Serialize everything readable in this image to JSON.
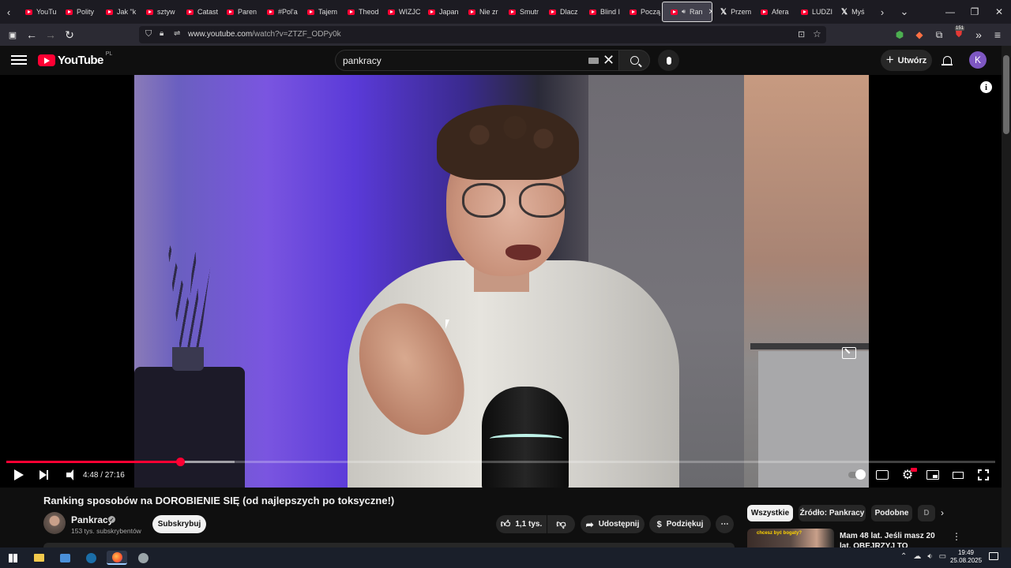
{
  "browser": {
    "tabs": [
      {
        "label": "YouTu",
        "icon": "youtube-icon"
      },
      {
        "label": "Polity",
        "icon": "youtube-icon"
      },
      {
        "label": "Jak \"k",
        "icon": "youtube-icon"
      },
      {
        "label": "sztyw",
        "icon": "youtube-icon"
      },
      {
        "label": "Catast",
        "icon": "youtube-icon"
      },
      {
        "label": "Paren",
        "icon": "youtube-icon"
      },
      {
        "label": "#Pol'a",
        "icon": "youtube-icon"
      },
      {
        "label": "Tajem",
        "icon": "youtube-icon"
      },
      {
        "label": "Theod",
        "icon": "youtube-icon"
      },
      {
        "label": "WIZJC",
        "icon": "youtube-icon"
      },
      {
        "label": "Japan",
        "icon": "youtube-icon"
      },
      {
        "label": "Nie zr",
        "icon": "youtube-icon"
      },
      {
        "label": "Smutr",
        "icon": "youtube-icon"
      },
      {
        "label": "Dlacz",
        "icon": "youtube-icon"
      },
      {
        "label": "Blind I",
        "icon": "youtube-icon"
      },
      {
        "label": "Począ",
        "icon": "youtube-icon"
      }
    ],
    "active_tab": {
      "label": "Ran",
      "icon": "youtube-icon",
      "close": "✕"
    },
    "tabs_after": [
      {
        "label": "Przem",
        "icon": "x-icon"
      },
      {
        "label": "Afera",
        "icon": "youtube-icon"
      },
      {
        "label": "LUDZI",
        "icon": "youtube-icon"
      },
      {
        "label": "Myś",
        "icon": "x-icon"
      }
    ],
    "url_host": "www.youtube.com",
    "url_path": "/watch?v=ZTZF_ODPy0k",
    "extension_badge": "151"
  },
  "youtube": {
    "logo_text": "YouTube",
    "logo_country": "PL",
    "search_value": "pankracy",
    "create_label": "Utwórz",
    "avatar_letter": "K"
  },
  "player": {
    "time_current": "4:48",
    "time_total": "27:16",
    "time_display": "4:48 / 27:16",
    "progress_fraction": 0.176,
    "buffered_fraction": 0.231,
    "accent_color": "#ff0033"
  },
  "video": {
    "title": "Ranking sposobów na DOROBIENIE SIĘ (od najlepszych po toksyczne!)",
    "channel": "Pankracy",
    "subscribers": "153 tys. subskrybentów",
    "subscribe_label": "Subskrybuj",
    "likes": "1,1 tys.",
    "share_label": "Udostępnij",
    "thanks_label": "Podziękuj"
  },
  "sidebar": {
    "chips": [
      "Wszystkie",
      "Źródło: Pankracy",
      "Podobne",
      "D"
    ],
    "recommendation_title": "Mam 48 lat. Jeśli masz 20 lat, OBEJRZYJ TO",
    "recommendation_thumb_text": "chcesz być bogaty?"
  },
  "taskbar": {
    "time": "19:49",
    "date": "25.08.2025"
  }
}
